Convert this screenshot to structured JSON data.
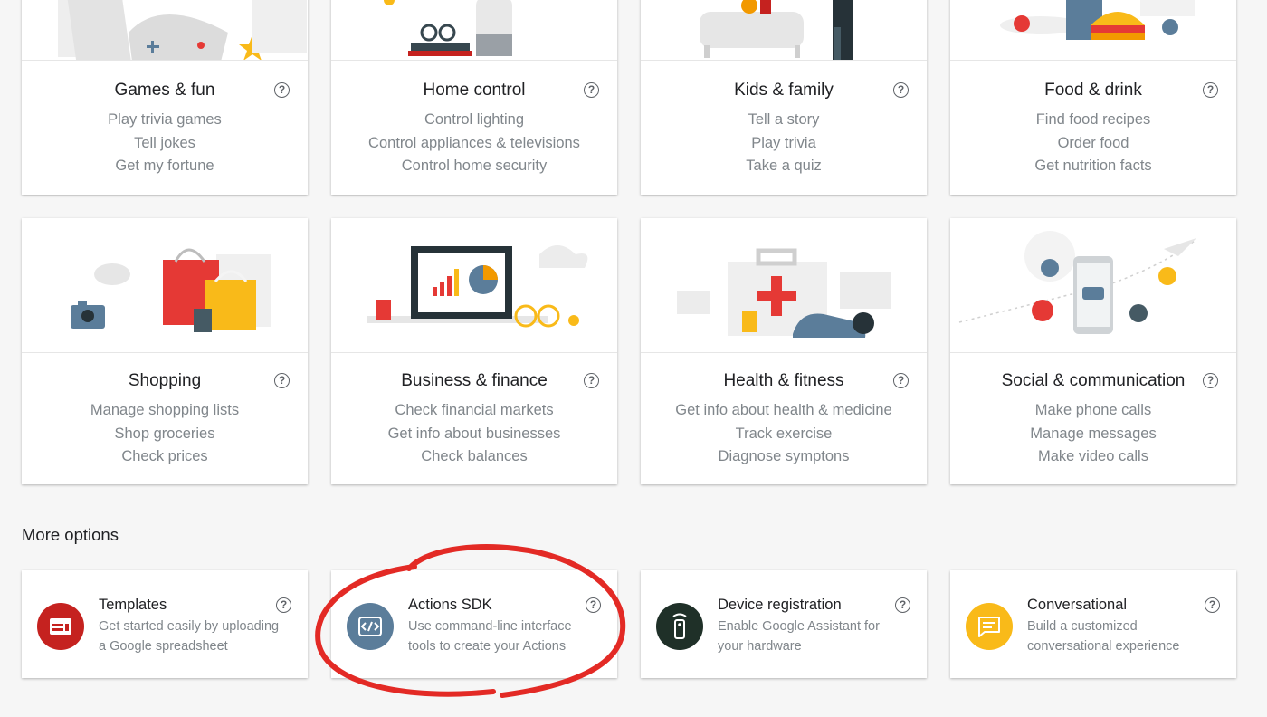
{
  "categories": [
    {
      "title": "Games & fun",
      "items": [
        "Play trivia games",
        "Tell jokes",
        "Get my fortune"
      ]
    },
    {
      "title": "Home control",
      "items": [
        "Control lighting",
        "Control appliances & televisions",
        "Control home security"
      ]
    },
    {
      "title": "Kids & family",
      "items": [
        "Tell a story",
        "Play trivia",
        "Take a quiz"
      ]
    },
    {
      "title": "Food & drink",
      "items": [
        "Find food recipes",
        "Order food",
        "Get nutrition facts"
      ]
    },
    {
      "title": "Shopping",
      "items": [
        "Manage shopping lists",
        "Shop groceries",
        "Check prices"
      ]
    },
    {
      "title": "Business & finance",
      "items": [
        "Check financial markets",
        "Get info about businesses",
        "Check balances"
      ]
    },
    {
      "title": "Health & fitness",
      "items": [
        "Get info about health & medicine",
        "Track exercise",
        "Diagnose symptons"
      ]
    },
    {
      "title": "Social & communication",
      "items": [
        "Make phone calls",
        "Manage messages",
        "Make video calls"
      ]
    }
  ],
  "help_glyph": "?",
  "more_options": {
    "title": "More options",
    "items": [
      {
        "title": "Templates",
        "desc_1": "Get started easily by uploading",
        "desc_2": "a Google spreadsheet",
        "icon": "spreadsheet-icon",
        "color": "#c5221f"
      },
      {
        "title": "Actions SDK",
        "desc_1": "Use command-line interface",
        "desc_2": "tools to create your Actions",
        "icon": "code-icon",
        "color": "#5b7d9a"
      },
      {
        "title": "Device registration",
        "desc_1": "Enable Google Assistant for",
        "desc_2": "your hardware",
        "icon": "device-icon",
        "color": "#1f3028"
      },
      {
        "title": "Conversational",
        "desc_1": "Build a customized",
        "desc_2": "conversational experience",
        "icon": "chat-icon",
        "color": "#f9ba19"
      }
    ]
  },
  "annotation_color": "#e32a25"
}
